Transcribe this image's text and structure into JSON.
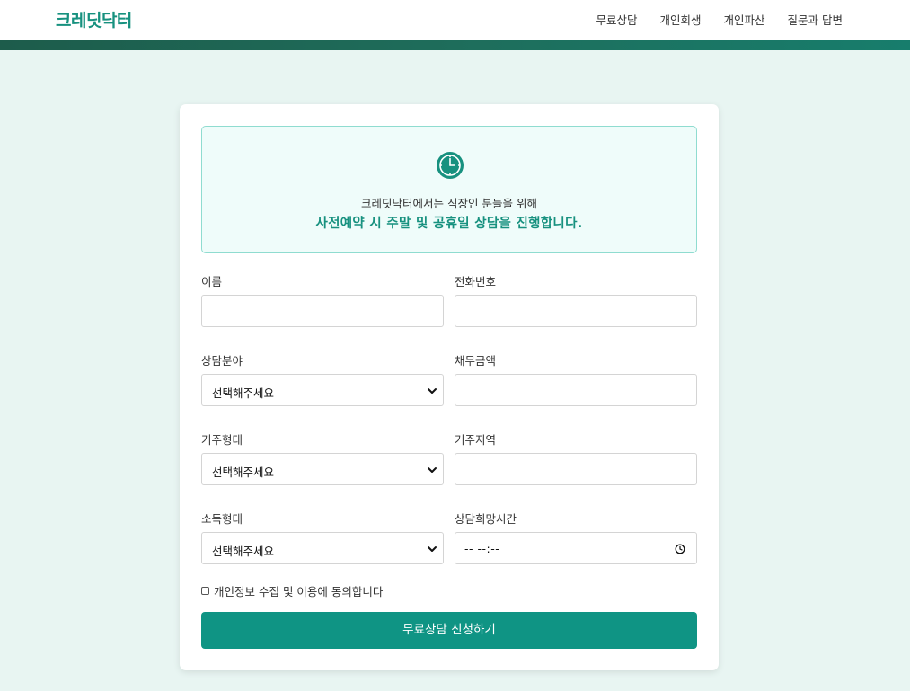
{
  "header": {
    "logo": "크레딧닥터",
    "nav": [
      "무료상담",
      "개인회생",
      "개인파산",
      "질문과 답변"
    ]
  },
  "notice": {
    "icon": "clock-icon",
    "line1": "크레딧닥터에서는 직장인 분들을 위해",
    "line2": "사전예약 시 주말 및 공휴일 상담을 진행합니다."
  },
  "form": {
    "name_label": "이름",
    "phone_label": "전화번호",
    "field_label": "상담분야",
    "debt_label": "채무금액",
    "housing_label": "거주형태",
    "region_label": "거주지역",
    "income_label": "소득형태",
    "time_label": "상담희망시간",
    "select_placeholder": "선택해주세요",
    "time_placeholder": "-- --:--",
    "agree_label": "개인정보 수집 및 이용에 동의합니다",
    "submit_label": "무료상담 신청하기"
  },
  "colors": {
    "accent": "#0f9484",
    "logo": "#17917f",
    "background": "#e8f5f2",
    "band": "#1d5c4b"
  }
}
